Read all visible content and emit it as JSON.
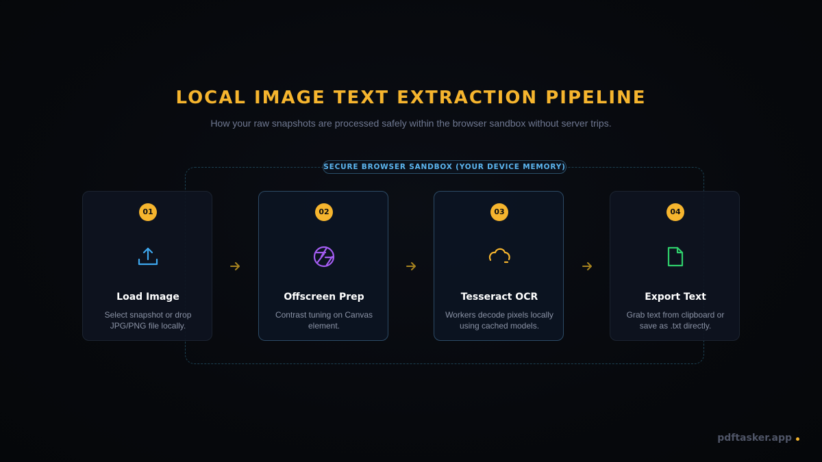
{
  "header": {
    "title": "LOCAL IMAGE TEXT EXTRACTION PIPELINE",
    "subtitle": "How your raw snapshots are processed safely within the browser sandbox without server trips."
  },
  "sandbox": {
    "label": "SECURE BROWSER SANDBOX (YOUR DEVICE MEMORY)"
  },
  "steps": [
    {
      "number": "01",
      "icon": "upload-icon",
      "icon_color": "#3ea8ef",
      "title": "Load Image",
      "description": "Select snapshot or drop JPG/PNG file locally."
    },
    {
      "number": "02",
      "icon": "aperture-icon",
      "icon_color": "#a35cf0",
      "title": "Offscreen Prep",
      "description": "Contrast tuning on Canvas element."
    },
    {
      "number": "03",
      "icon": "cloud-icon",
      "icon_color": "#f6b52e",
      "title": "Tesseract OCR",
      "description": "Workers decode pixels locally using cached models."
    },
    {
      "number": "04",
      "icon": "file-icon",
      "icon_color": "#2fcf6b",
      "title": "Export Text",
      "description": "Grab text from clipboard or save as .txt directly."
    }
  ],
  "colors": {
    "accent": "#f6b52e",
    "sandbox_label": "#5cb6f0",
    "arrow": "#a8841f"
  },
  "footer": {
    "brand": "pdftasker.app"
  }
}
